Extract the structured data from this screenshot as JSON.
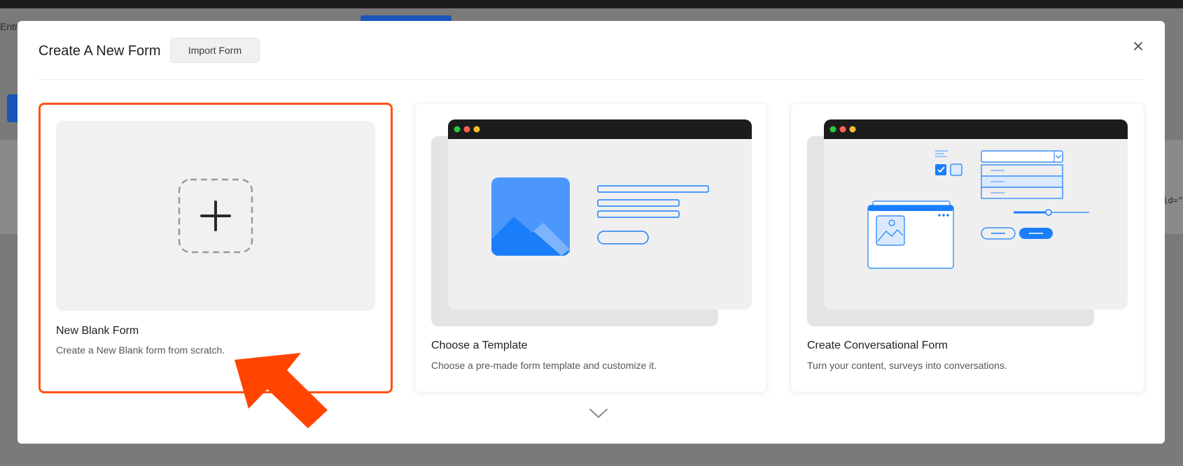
{
  "background": {
    "entries_text": "Entri",
    "code_text": "id=\""
  },
  "modal": {
    "title": "Create A New Form",
    "import_label": "Import Form",
    "close_icon": "close-icon"
  },
  "cards": [
    {
      "title": "New Blank Form",
      "description": "Create a New Blank form from scratch.",
      "selected": true,
      "icon": "plus-icon"
    },
    {
      "title": "Choose a Template",
      "description": "Choose a pre-made form template and customize it.",
      "selected": false,
      "icon": "template-illustration"
    },
    {
      "title": "Create Conversational Form",
      "description": "Turn your content, surveys into conversations.",
      "selected": false,
      "icon": "conversational-illustration"
    }
  ],
  "footer": {
    "more_icon": "chevron-down-icon"
  },
  "colors": {
    "accent_selected": "#fd5214",
    "brand_blue": "#1a7efb",
    "annotation_arrow": "#ff4500"
  }
}
